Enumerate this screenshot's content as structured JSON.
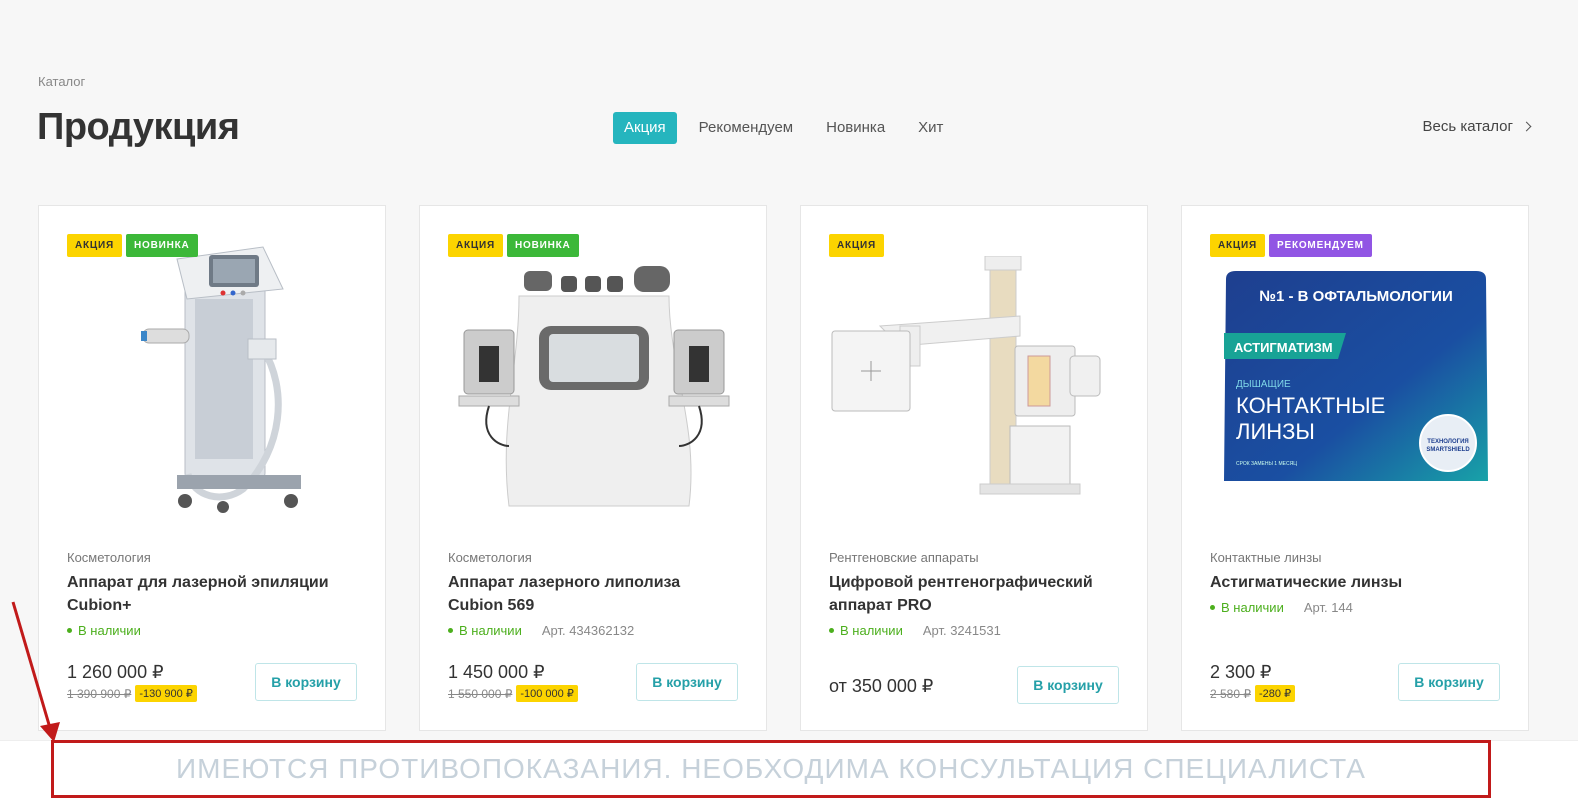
{
  "breadcrumb": "Каталог",
  "page_title": "Продукция",
  "tabs": [
    {
      "label": "Акция",
      "active": true
    },
    {
      "label": "Рекомендуем",
      "active": false
    },
    {
      "label": "Новинка",
      "active": false
    },
    {
      "label": "Хит",
      "active": false
    }
  ],
  "all_catalog_label": "Весь каталог",
  "accent_color": "#25b5be",
  "products": [
    {
      "badges": [
        "Акция",
        "Новинка"
      ],
      "category": "Косметология",
      "title": "Аппарат для лазерной эпиляции Cubion+",
      "stock": "В наличии",
      "sku": "",
      "price": "1 260 000 ₽",
      "old_price": "1 390 900 ₽",
      "discount": "-130 900 ₽",
      "cart_label": "В корзину",
      "image_icon": "laser-epilation-machine-icon"
    },
    {
      "badges": [
        "Акция",
        "Новинка"
      ],
      "category": "Косметология",
      "title": "Аппарат лазерного липолиза Cubion 569",
      "stock": "В наличии",
      "sku": "Арт. 434362132",
      "price": "1 450 000 ₽",
      "old_price": "1 550 000 ₽",
      "discount": "-100 000 ₽",
      "cart_label": "В корзину",
      "image_icon": "lipolysis-machine-icon"
    },
    {
      "badges": [
        "Акция"
      ],
      "category": "Рентгеновские аппараты",
      "title": "Цифровой рентгенографический аппарат PRO",
      "stock": "В наличии",
      "sku": "Арт. 3241531",
      "price": "от 350 000 ₽",
      "old_price": "",
      "discount": "",
      "cart_label": "В корзину",
      "image_icon": "x-ray-machine-icon"
    },
    {
      "badges": [
        "Акция",
        "Рекомендуем"
      ],
      "category": "Контактные линзы",
      "title": "Астигматические линзы",
      "stock": "В наличии",
      "sku": "Арт. 144",
      "price": "2 300 ₽",
      "old_price": "2 580 ₽",
      "discount": "-280 ₽",
      "cart_label": "В корзину",
      "image_icon": "contact-lens-box-icon",
      "box_text": {
        "top": "№1 - В ОФТАЛЬМОЛОГИИ",
        "strip": "АСТИГМАТИЗМ",
        "small": "ДЫШАЩИЕ",
        "big1": "КОНТАКТНЫЕ",
        "big2": "ЛИНЗЫ",
        "seal1": "ТЕХНОЛОГИЯ",
        "seal2": "SMARTSHIELD",
        "foot": "СРОК ЗАМЕНЫ 1 МЕСЯЦ"
      }
    }
  ],
  "warning": "ИМЕЮТСЯ ПРОТИВОПОКАЗАНИЯ. НЕОБХОДИМА КОНСУЛЬТАЦИЯ СПЕЦИАЛИСТА"
}
